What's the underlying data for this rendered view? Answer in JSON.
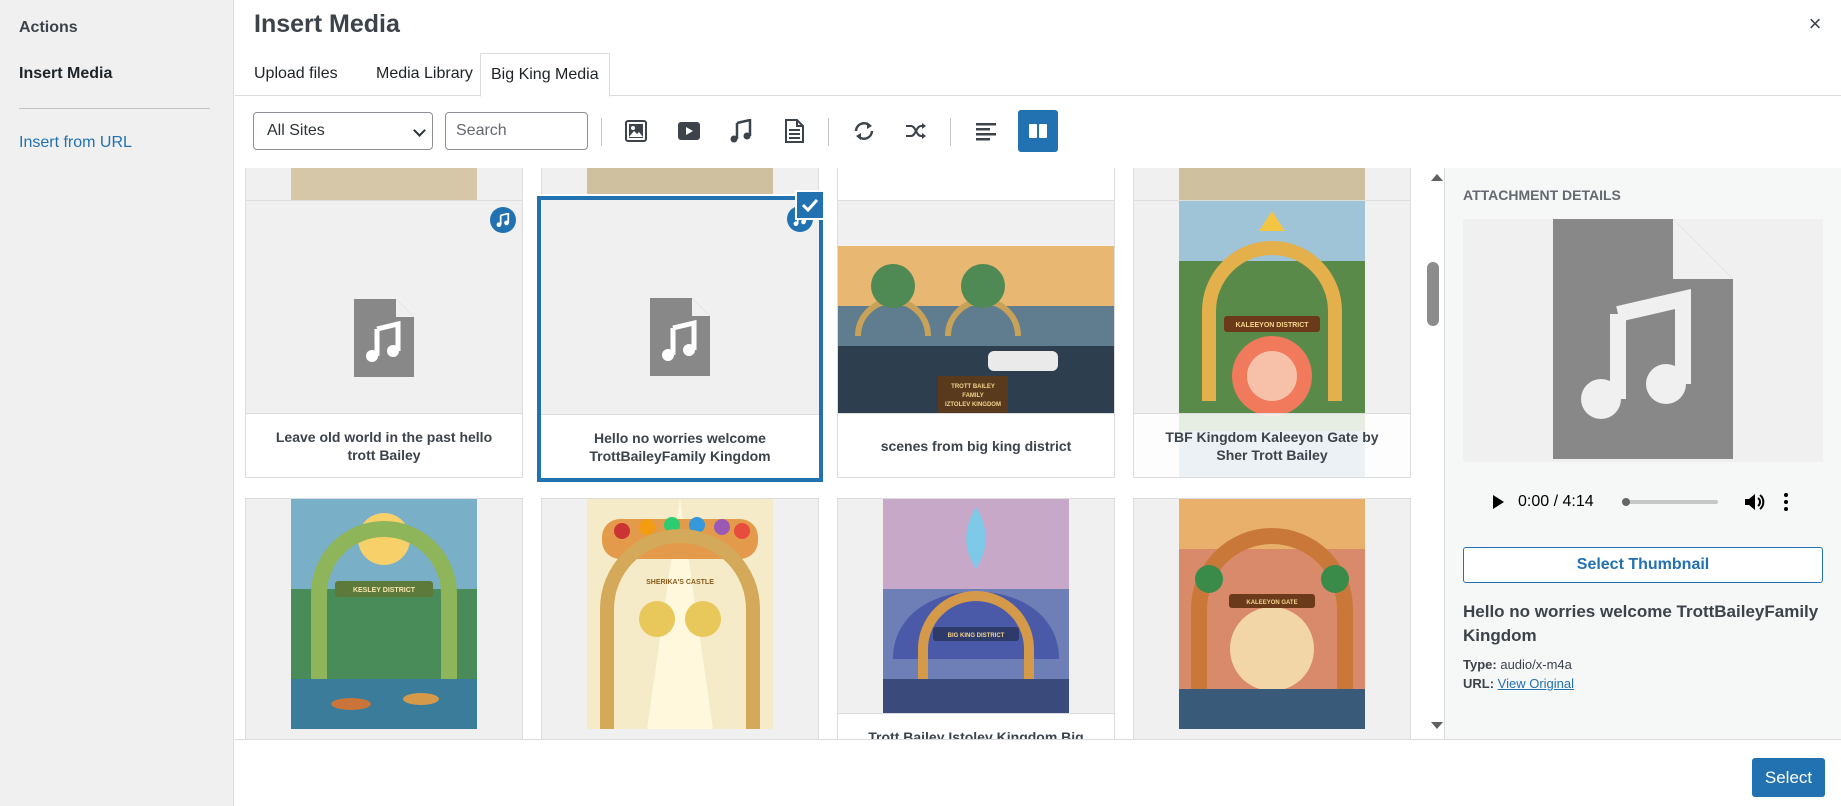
{
  "menu": {
    "heading": "Actions",
    "active_item": "Insert Media",
    "link": "Insert from URL"
  },
  "frame": {
    "title": "Insert Media",
    "close_glyph": "×"
  },
  "tabs": [
    {
      "label": "Upload files"
    },
    {
      "label": "Media Library"
    },
    {
      "label": "Big King Media"
    }
  ],
  "toolbar": {
    "site_filter": "All Sites",
    "search_placeholder": "Search",
    "icons": [
      "image-icon",
      "video-icon",
      "audio-icon",
      "document-icon",
      "refresh-icon",
      "shuffle-icon",
      "list-view-icon",
      "grid-view-icon"
    ]
  },
  "tiles": [
    {
      "caption": "Leave old world in the past hello trott Bailey",
      "kind": "audio"
    },
    {
      "caption": "Hello no worries welcome TrottBaileyFamily Kingdom",
      "kind": "audio",
      "selected": true
    },
    {
      "caption": "scenes from big king district",
      "kind": "image"
    },
    {
      "caption": "TBF Kingdom Kaleeyon Gate by Sher Trott Bailey",
      "kind": "image"
    },
    {
      "caption": "",
      "kind": "image"
    },
    {
      "caption": "",
      "kind": "image"
    },
    {
      "caption": "Trott Bailey Istolev Kingdom Big",
      "kind": "image"
    },
    {
      "caption": "",
      "kind": "image"
    }
  ],
  "thumb_text": {
    "scenes": [
      "TROTT BAILEY",
      "FAMILY",
      "IZTOLEV KINGDOM"
    ],
    "kaleeyon": "KALEEYON DISTRICT",
    "kesley": "KESLEY DISTRICT",
    "sherika": "SHERIKA'S CASTLE",
    "bigking": "BIG KING DISTRICT",
    "kaileah": "KALEEYON GATE"
  },
  "details": {
    "title": "ATTACHMENT DETAILS",
    "audio_time": "0:00 / 4:14",
    "thumbnail_button": "Select Thumbnail",
    "file_name": "Hello no worries welcome TrottBaileyFamily Kingdom",
    "type_label": "Type:",
    "type_value": "audio/x-m4a",
    "url_label": "URL:",
    "url_link": "View Original"
  },
  "footer": {
    "select_button": "Select"
  },
  "colors": {
    "accent": "#2271b1",
    "menu_bg": "#f0f0f1"
  }
}
